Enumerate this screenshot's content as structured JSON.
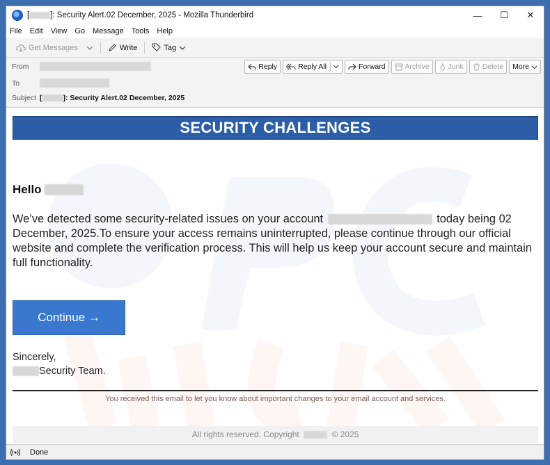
{
  "window": {
    "title_suffix": ": Security Alert.02 December, 2025 - Mozilla Thunderbird",
    "controls": [
      "—",
      "☐",
      "✕"
    ]
  },
  "menu": [
    "File",
    "Edit",
    "View",
    "Go",
    "Message",
    "Tools",
    "Help"
  ],
  "toolbar": {
    "get_messages": "Get Messages",
    "write": "Write",
    "tag": "Tag"
  },
  "headers": {
    "from_label": "From",
    "to_label": "To",
    "subject_label": "Subject",
    "subject_value": ": Security Alert.02 December, 2025",
    "actions": {
      "reply": "Reply",
      "reply_all": "Reply All",
      "forward": "Forward",
      "archive": "Archive",
      "junk": "Junk",
      "delete": "Delete",
      "more": "More"
    }
  },
  "email": {
    "banner": "SECURITY CHALLENGES",
    "greeting": "Hello",
    "para_part1": "We’ve detected some security-related issues on your account",
    "para_part2": "today being",
    "para_date": "02 December, 2025.",
    "para_part3": "To ensure your access remains uninterrupted, please continue through our official website and complete the verification process. This will help us keep your account secure and maintain full functionality.",
    "cta": "Continue →",
    "sign_line1": "Sincerely,",
    "sign_line2": "Security Team.",
    "notice": "You received this email to let you know about important changes to your email account and services.",
    "footer_left": "All rights reserved. Copyright",
    "footer_right": "© 2025"
  },
  "status": {
    "text": "Done"
  },
  "colors": {
    "banner_bg": "#2b5ea6",
    "cta_bg": "#3a78cf"
  }
}
